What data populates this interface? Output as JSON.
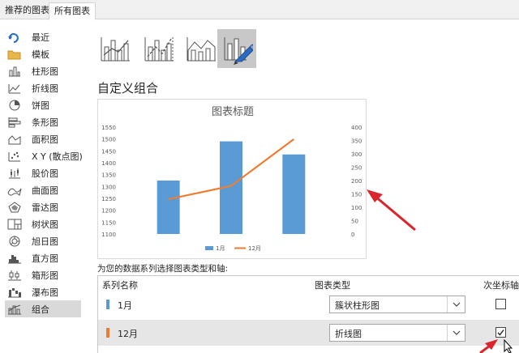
{
  "tabs": [
    {
      "label": "推荐的图表",
      "active": false
    },
    {
      "label": "所有图表",
      "active": true
    }
  ],
  "sidebar": {
    "items": [
      {
        "label": "最近",
        "icon": "recent-icon"
      },
      {
        "label": "模板",
        "icon": "folder-icon"
      },
      {
        "label": "柱形图",
        "icon": "column-chart-icon"
      },
      {
        "label": "折线图",
        "icon": "line-chart-icon"
      },
      {
        "label": "饼图",
        "icon": "pie-chart-icon"
      },
      {
        "label": "条形图",
        "icon": "bar-chart-icon"
      },
      {
        "label": "面积图",
        "icon": "area-chart-icon"
      },
      {
        "label": "X Y (散点图)",
        "icon": "scatter-chart-icon"
      },
      {
        "label": "股价图",
        "icon": "stock-chart-icon"
      },
      {
        "label": "曲面图",
        "icon": "surface-chart-icon"
      },
      {
        "label": "雷达图",
        "icon": "radar-chart-icon"
      },
      {
        "label": "树状图",
        "icon": "treemap-chart-icon"
      },
      {
        "label": "旭日图",
        "icon": "sunburst-chart-icon"
      },
      {
        "label": "直方图",
        "icon": "histogram-chart-icon"
      },
      {
        "label": "箱形图",
        "icon": "boxplot-chart-icon"
      },
      {
        "label": "瀑布图",
        "icon": "waterfall-chart-icon"
      },
      {
        "label": "组合",
        "icon": "combo-chart-icon",
        "active": true
      }
    ]
  },
  "subtypes": [
    {
      "name": "clustered-column-line-icon",
      "selected": false
    },
    {
      "name": "clustered-column-line-secondary-icon",
      "selected": false
    },
    {
      "name": "stacked-area-column-icon",
      "selected": false
    },
    {
      "name": "custom-combo-icon",
      "selected": true
    }
  ],
  "section_title": "自定义组合",
  "chart_data": {
    "type": "bar",
    "title": "图表标题",
    "categories": [
      ""
    ],
    "series": [
      {
        "name": "1月",
        "chart": "bar",
        "axis": "primary",
        "values": [
          1325,
          1490,
          1435
        ]
      },
      {
        "name": "12月",
        "chart": "line",
        "axis": "secondary",
        "values": [
          130,
          180,
          355
        ]
      }
    ],
    "primary_axis": {
      "ylim": [
        1100,
        1550
      ],
      "ticks": [
        "1100",
        "1150",
        "1200",
        "1250",
        "1300",
        "1350",
        "1400",
        "1450",
        "1500",
        "1550"
      ]
    },
    "secondary_axis": {
      "ylim": [
        0,
        400
      ],
      "ticks": [
        "0",
        "50",
        "100",
        "150",
        "200",
        "250",
        "300",
        "350",
        "400"
      ]
    },
    "grid": false,
    "legend": "bottom",
    "colors": {
      "bar": "#5b9bd5",
      "line": "#ed7d31"
    }
  },
  "prompt": "为您的数据系列选择图表类型和轴:",
  "table": {
    "headers": {
      "name": "系列名称",
      "type": "图表类型",
      "secondary": "次坐标轴"
    },
    "rows": [
      {
        "name": "1月",
        "color": "#5b9bd5",
        "type": "簇状柱形图",
        "secondary": false
      },
      {
        "name": "12月",
        "color": "#ed7d31",
        "type": "折线图",
        "secondary": true
      }
    ]
  },
  "colors": {
    "arrow": "#d9262c",
    "accent": "#2b6cc4"
  }
}
